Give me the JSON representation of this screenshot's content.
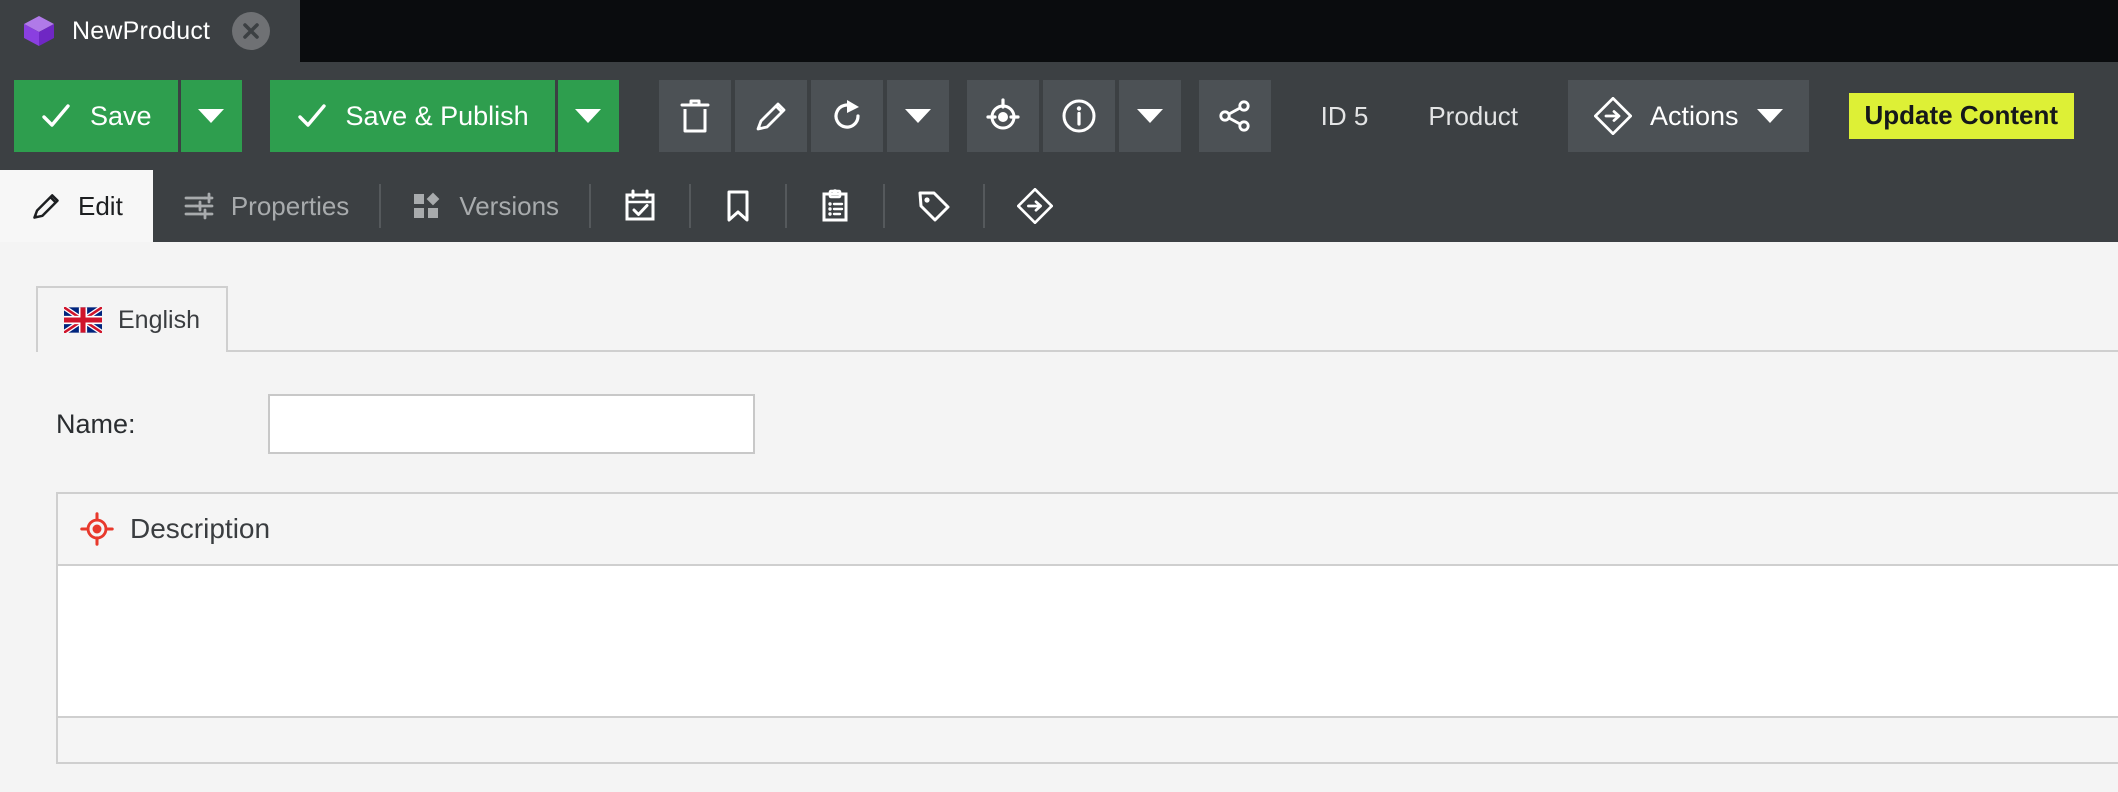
{
  "window": {
    "doc_tab": {
      "title": "NewProduct",
      "icon": "cube-icon",
      "close_icon": "close-icon"
    }
  },
  "toolbar": {
    "save_label": "Save",
    "save_caret_icon": "chevron-down-icon",
    "save_publish_label": "Save & Publish",
    "save_publish_caret_icon": "chevron-down-icon",
    "check_icon": "check-icon",
    "icons": [
      {
        "name": "delete-icon",
        "title": "Delete"
      },
      {
        "name": "edit-pencil-icon",
        "title": "Edit"
      },
      {
        "name": "refresh-icon",
        "title": "Refresh"
      },
      {
        "name": "refresh-caret-icon",
        "title": "Refresh options"
      },
      {
        "name": "target-icon",
        "title": "Target"
      },
      {
        "name": "info-icon",
        "title": "Info"
      },
      {
        "name": "info-caret-icon",
        "title": "Info options"
      },
      {
        "name": "share-icon",
        "title": "Share"
      }
    ],
    "id_label": "ID 5",
    "type_label": "Product",
    "actions_label": "Actions",
    "actions_icon": "diamond-arrow-icon",
    "actions_caret_icon": "chevron-down-icon",
    "update_content_label": "Update Content",
    "colors": {
      "green": "#2e9e4e",
      "highlight": "#ddf036",
      "toolbar_bg": "#3c4043",
      "icon_bg": "#4c5155"
    }
  },
  "tabs": [
    {
      "label": "Edit",
      "icon": "edit-pencil-icon",
      "active": true
    },
    {
      "label": "Properties",
      "icon": "sliders-icon",
      "active": false
    },
    {
      "label": "Versions",
      "icon": "versions-icon",
      "active": false
    },
    {
      "label": "",
      "icon": "calendar-check-icon",
      "active": false
    },
    {
      "label": "",
      "icon": "bookmark-icon",
      "active": false
    },
    {
      "label": "",
      "icon": "clipboard-list-icon",
      "active": false
    },
    {
      "label": "",
      "icon": "tag-icon",
      "active": false
    },
    {
      "label": "",
      "icon": "diamond-arrow-icon",
      "active": false
    }
  ],
  "content": {
    "language_tab": {
      "label": "English",
      "flag": "uk-flag-icon"
    },
    "name_field": {
      "label": "Name:",
      "value": "",
      "placeholder": ""
    },
    "description_section": {
      "title": "Description",
      "icon": "red-target-icon",
      "icon_color": "#e8392c",
      "body_text": ""
    }
  }
}
